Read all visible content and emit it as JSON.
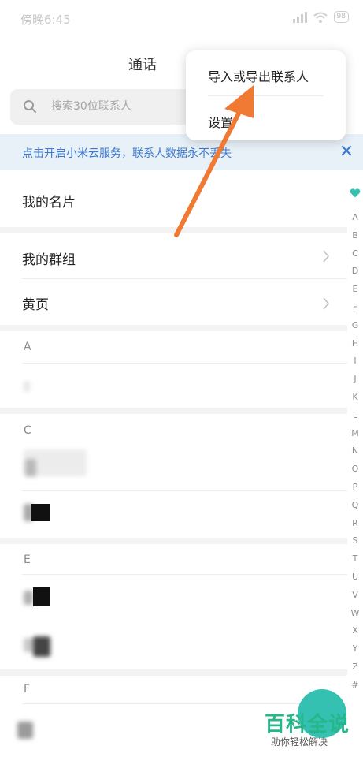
{
  "status_bar": {
    "time": "傍晚6:45",
    "battery": "98"
  },
  "header": {
    "tab_title": "通话"
  },
  "search": {
    "placeholder": "搜索30位联系人"
  },
  "popup_menu": {
    "items": [
      {
        "label": "导入或导出联系人"
      },
      {
        "label": "设置"
      }
    ]
  },
  "cloud_banner": {
    "text": "点击开启小米云服务，联系人数据永不丢失"
  },
  "list": {
    "my_card": "我的名片",
    "my_groups": "我的群组",
    "yellow_pages": "黄页",
    "sections": [
      "A",
      "C",
      "E",
      "F"
    ]
  },
  "alphabet_index": [
    "A",
    "B",
    "C",
    "D",
    "E",
    "F",
    "G",
    "H",
    "I",
    "J",
    "K",
    "L",
    "M",
    "N",
    "O",
    "P",
    "Q",
    "R",
    "S",
    "T",
    "U",
    "V",
    "W",
    "X",
    "Y",
    "Z",
    "#"
  ],
  "watermark": {
    "main": "百科全说",
    "sub": "助你轻松解决"
  },
  "colors": {
    "accent": "#35c1b2",
    "banner_bg": "#e8f0f8",
    "banner_text": "#3b7ad1",
    "arrow": "#f07a33"
  }
}
